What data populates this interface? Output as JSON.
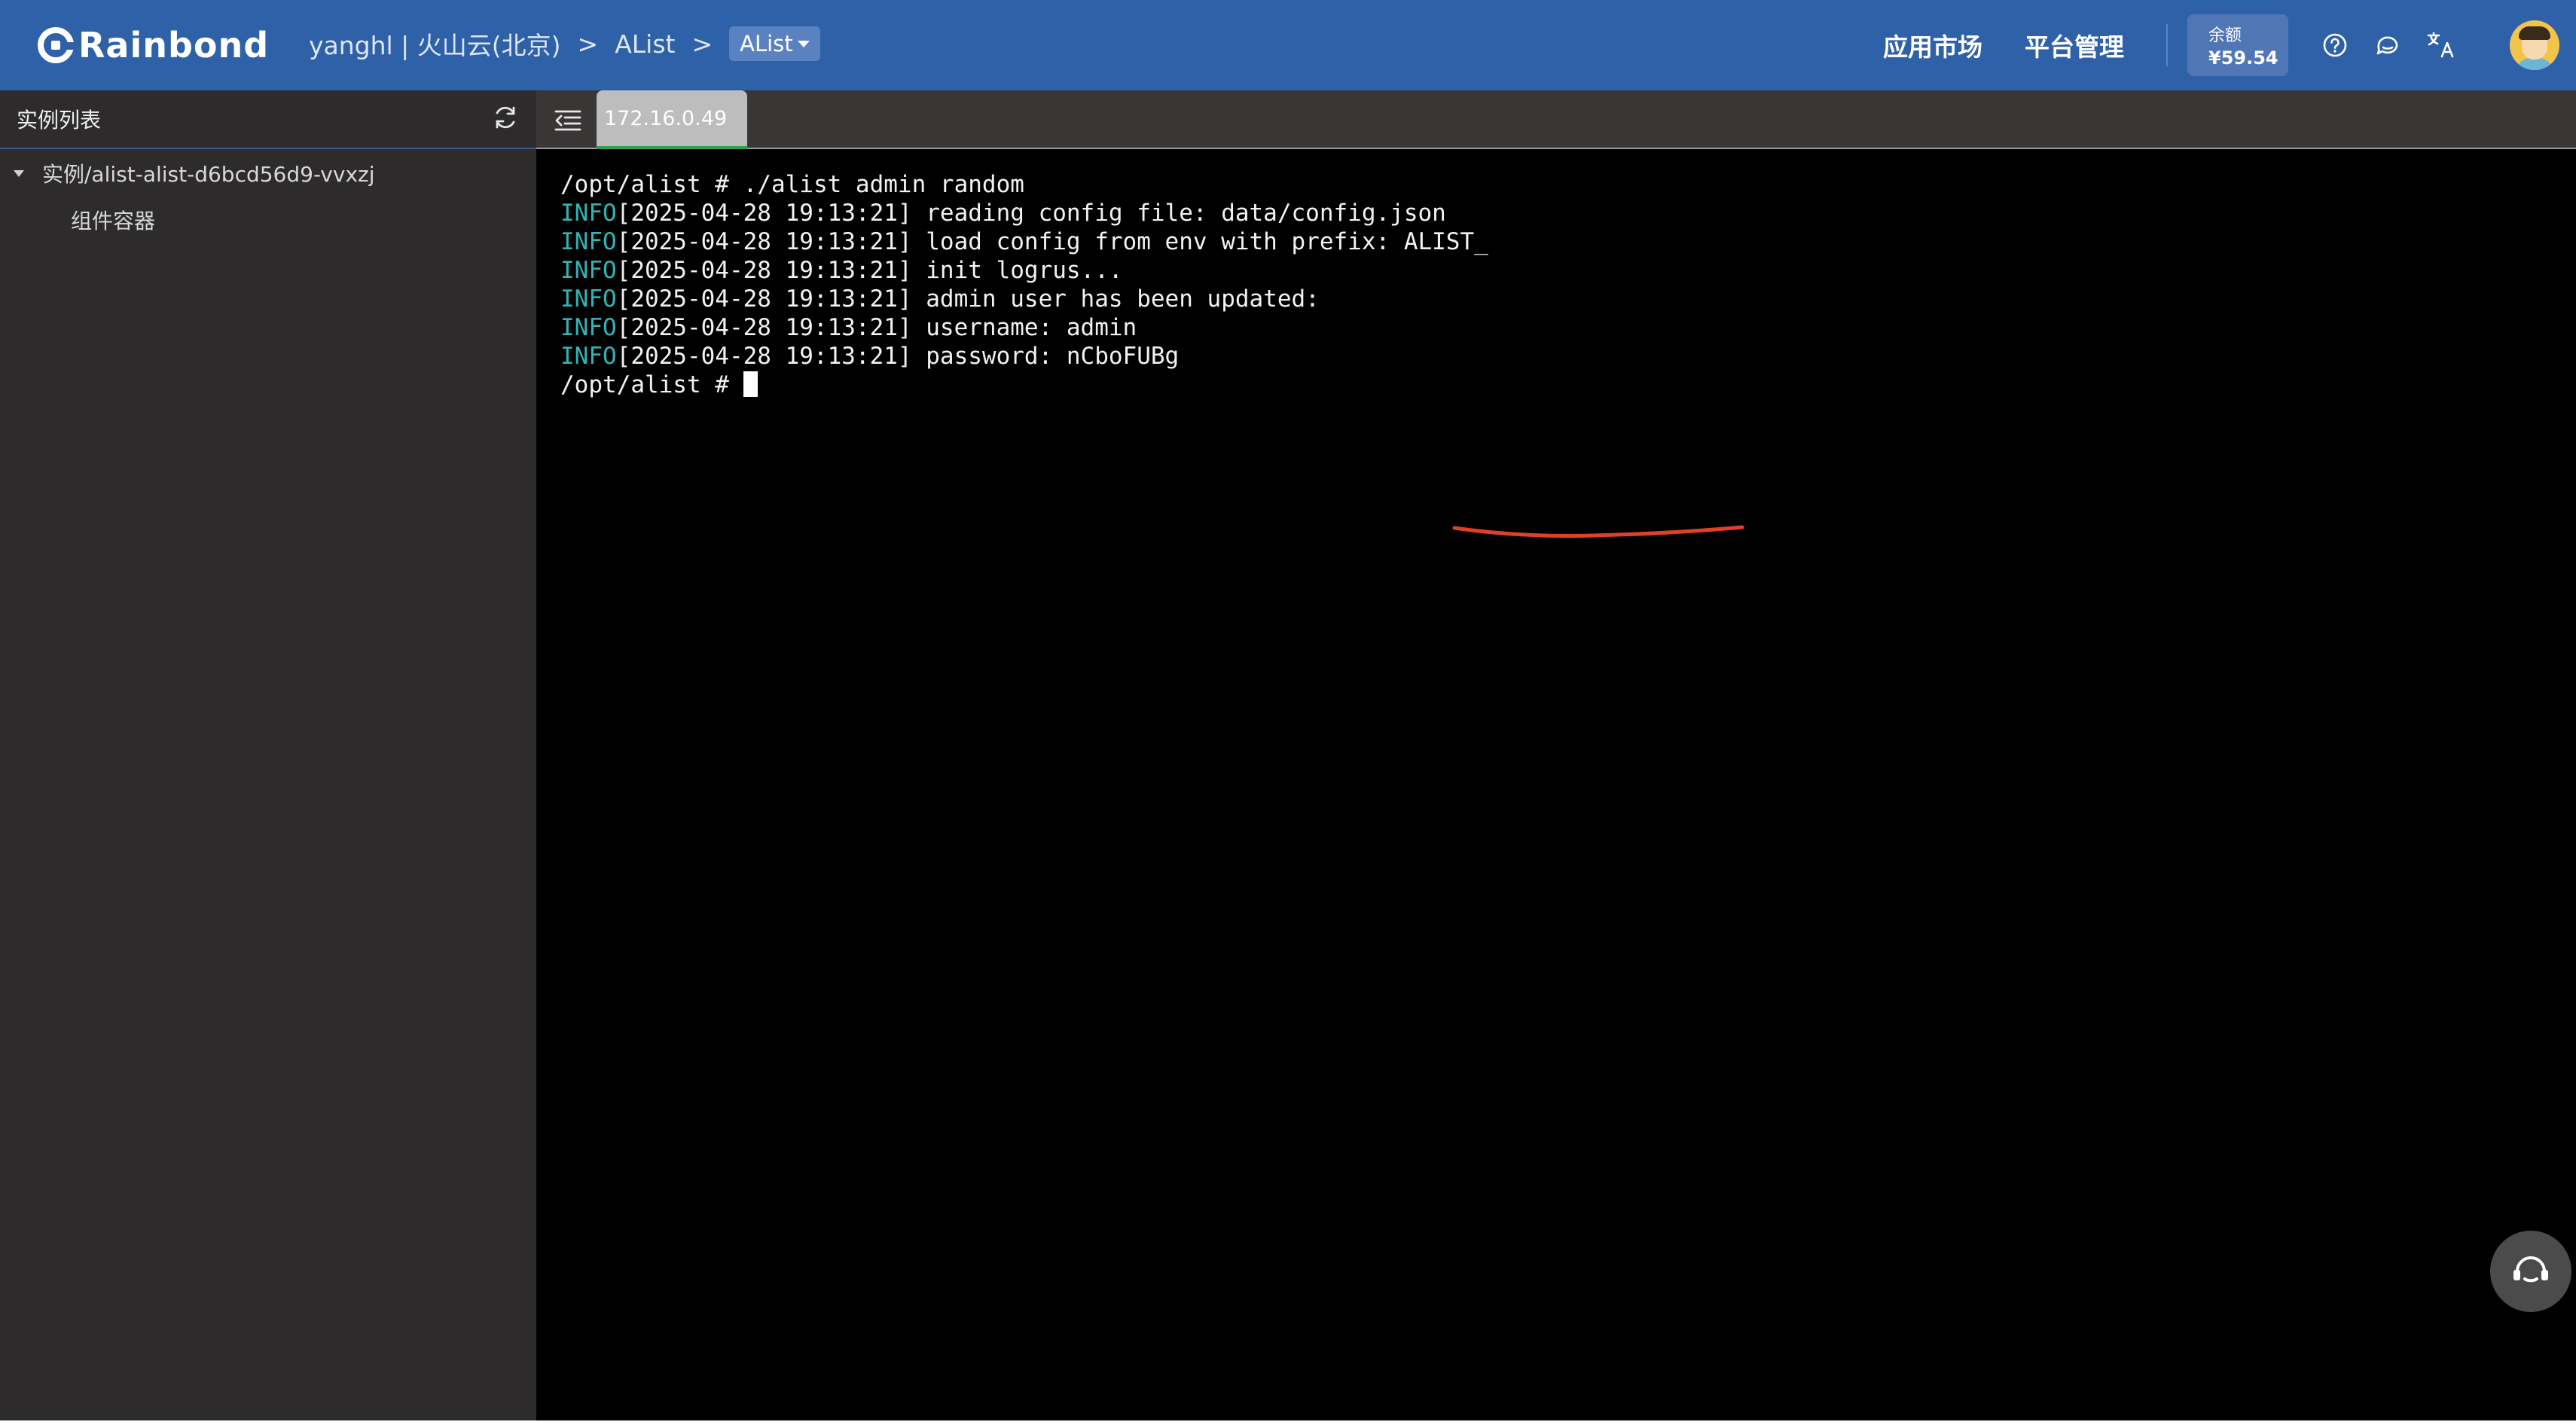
{
  "header": {
    "brand": "Rainbond",
    "breadcrumb": {
      "team_region": "yanghl | 火山云(北京)",
      "separator": ">",
      "app": "AList",
      "current": "AList"
    },
    "nav": {
      "market": "应用市场",
      "platform": "平台管理"
    },
    "balance": {
      "label": "余额",
      "value": "¥59.54"
    },
    "icons": [
      "help-icon",
      "message-icon",
      "translate-icon"
    ]
  },
  "sidebar": {
    "title": "实例列表",
    "instance": "实例/alist-alist-d6bcd56d9-vvxzj",
    "container": "组件容器"
  },
  "tabs": [
    {
      "label": "172.16.0.49",
      "active": true
    }
  ],
  "terminal": {
    "lines": [
      {
        "level": "",
        "text": "/opt/alist # ./alist admin random"
      },
      {
        "level": "INFO",
        "text": "[2025-04-28 19:13:21] reading config file: data/config.json"
      },
      {
        "level": "INFO",
        "text": "[2025-04-28 19:13:21] load config from env with prefix: ALIST_"
      },
      {
        "level": "INFO",
        "text": "[2025-04-28 19:13:21] init logrus..."
      },
      {
        "level": "INFO",
        "text": "[2025-04-28 19:13:21] admin user has been updated:"
      },
      {
        "level": "INFO",
        "text": "[2025-04-28 19:13:21] username: admin"
      },
      {
        "level": "INFO",
        "text": "[2025-04-28 19:13:21] password: nCboFUBg"
      }
    ],
    "prompt": "/opt/alist # ",
    "colors": {
      "background": "#000000",
      "text": "#f2f2f2",
      "level": "#34b3b5",
      "annotation": "#e0402a"
    }
  },
  "colors": {
    "header": "#2f61a8",
    "sidebar": "#2d2b2b"
  }
}
